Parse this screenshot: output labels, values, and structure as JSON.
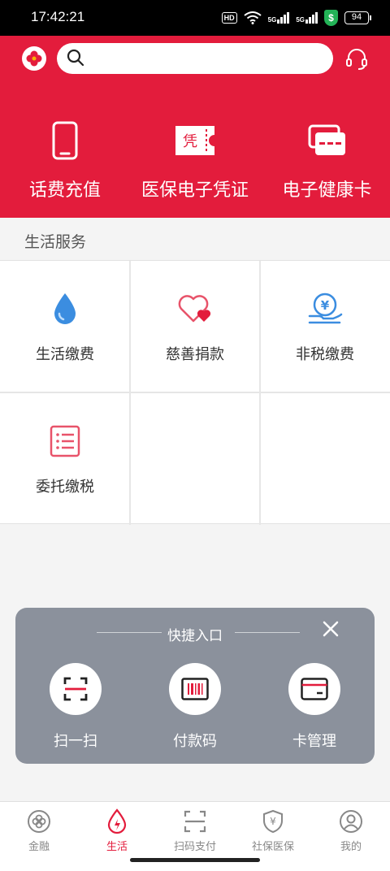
{
  "status_bar": {
    "time": "17:42:21",
    "hd": "HD",
    "net1": "5G",
    "net2": "5G",
    "shield": "$",
    "battery": "94"
  },
  "header": {
    "search": {
      "placeholder": ""
    },
    "quick_actions": [
      {
        "label": "话费充值",
        "icon": "phone-icon"
      },
      {
        "label": "医保电子凭证",
        "icon": "voucher-icon",
        "badge": "凭"
      },
      {
        "label": "电子健康卡",
        "icon": "health-card-icon"
      }
    ]
  },
  "services": {
    "title": "生活服务",
    "items": [
      {
        "label": "生活缴费",
        "icon": "water-drop-icon"
      },
      {
        "label": "慈善捐款",
        "icon": "heart-icon"
      },
      {
        "label": "非税缴费",
        "icon": "yen-hand-icon",
        "symbol": "¥"
      },
      {
        "label": "委托缴税",
        "icon": "list-icon"
      }
    ]
  },
  "quick_panel": {
    "title": "快捷入口",
    "items": [
      {
        "label": "扫一扫",
        "icon": "scan-icon"
      },
      {
        "label": "付款码",
        "icon": "barcode-icon"
      },
      {
        "label": "卡管理",
        "icon": "card-icon"
      }
    ]
  },
  "bottom_nav": {
    "items": [
      {
        "label": "金融",
        "icon": "finance-icon",
        "active": false
      },
      {
        "label": "生活",
        "icon": "life-icon",
        "active": true
      },
      {
        "label": "扫码支付",
        "icon": "scan-pay-icon",
        "active": false
      },
      {
        "label": "社保医保",
        "icon": "insurance-icon",
        "active": false,
        "symbol": "¥"
      },
      {
        "label": "我的",
        "icon": "profile-icon",
        "active": false
      }
    ]
  },
  "colors": {
    "brand_red": "#e31c3c",
    "panel_gray": "#8b919c",
    "icon_blue": "#3b8de0"
  }
}
